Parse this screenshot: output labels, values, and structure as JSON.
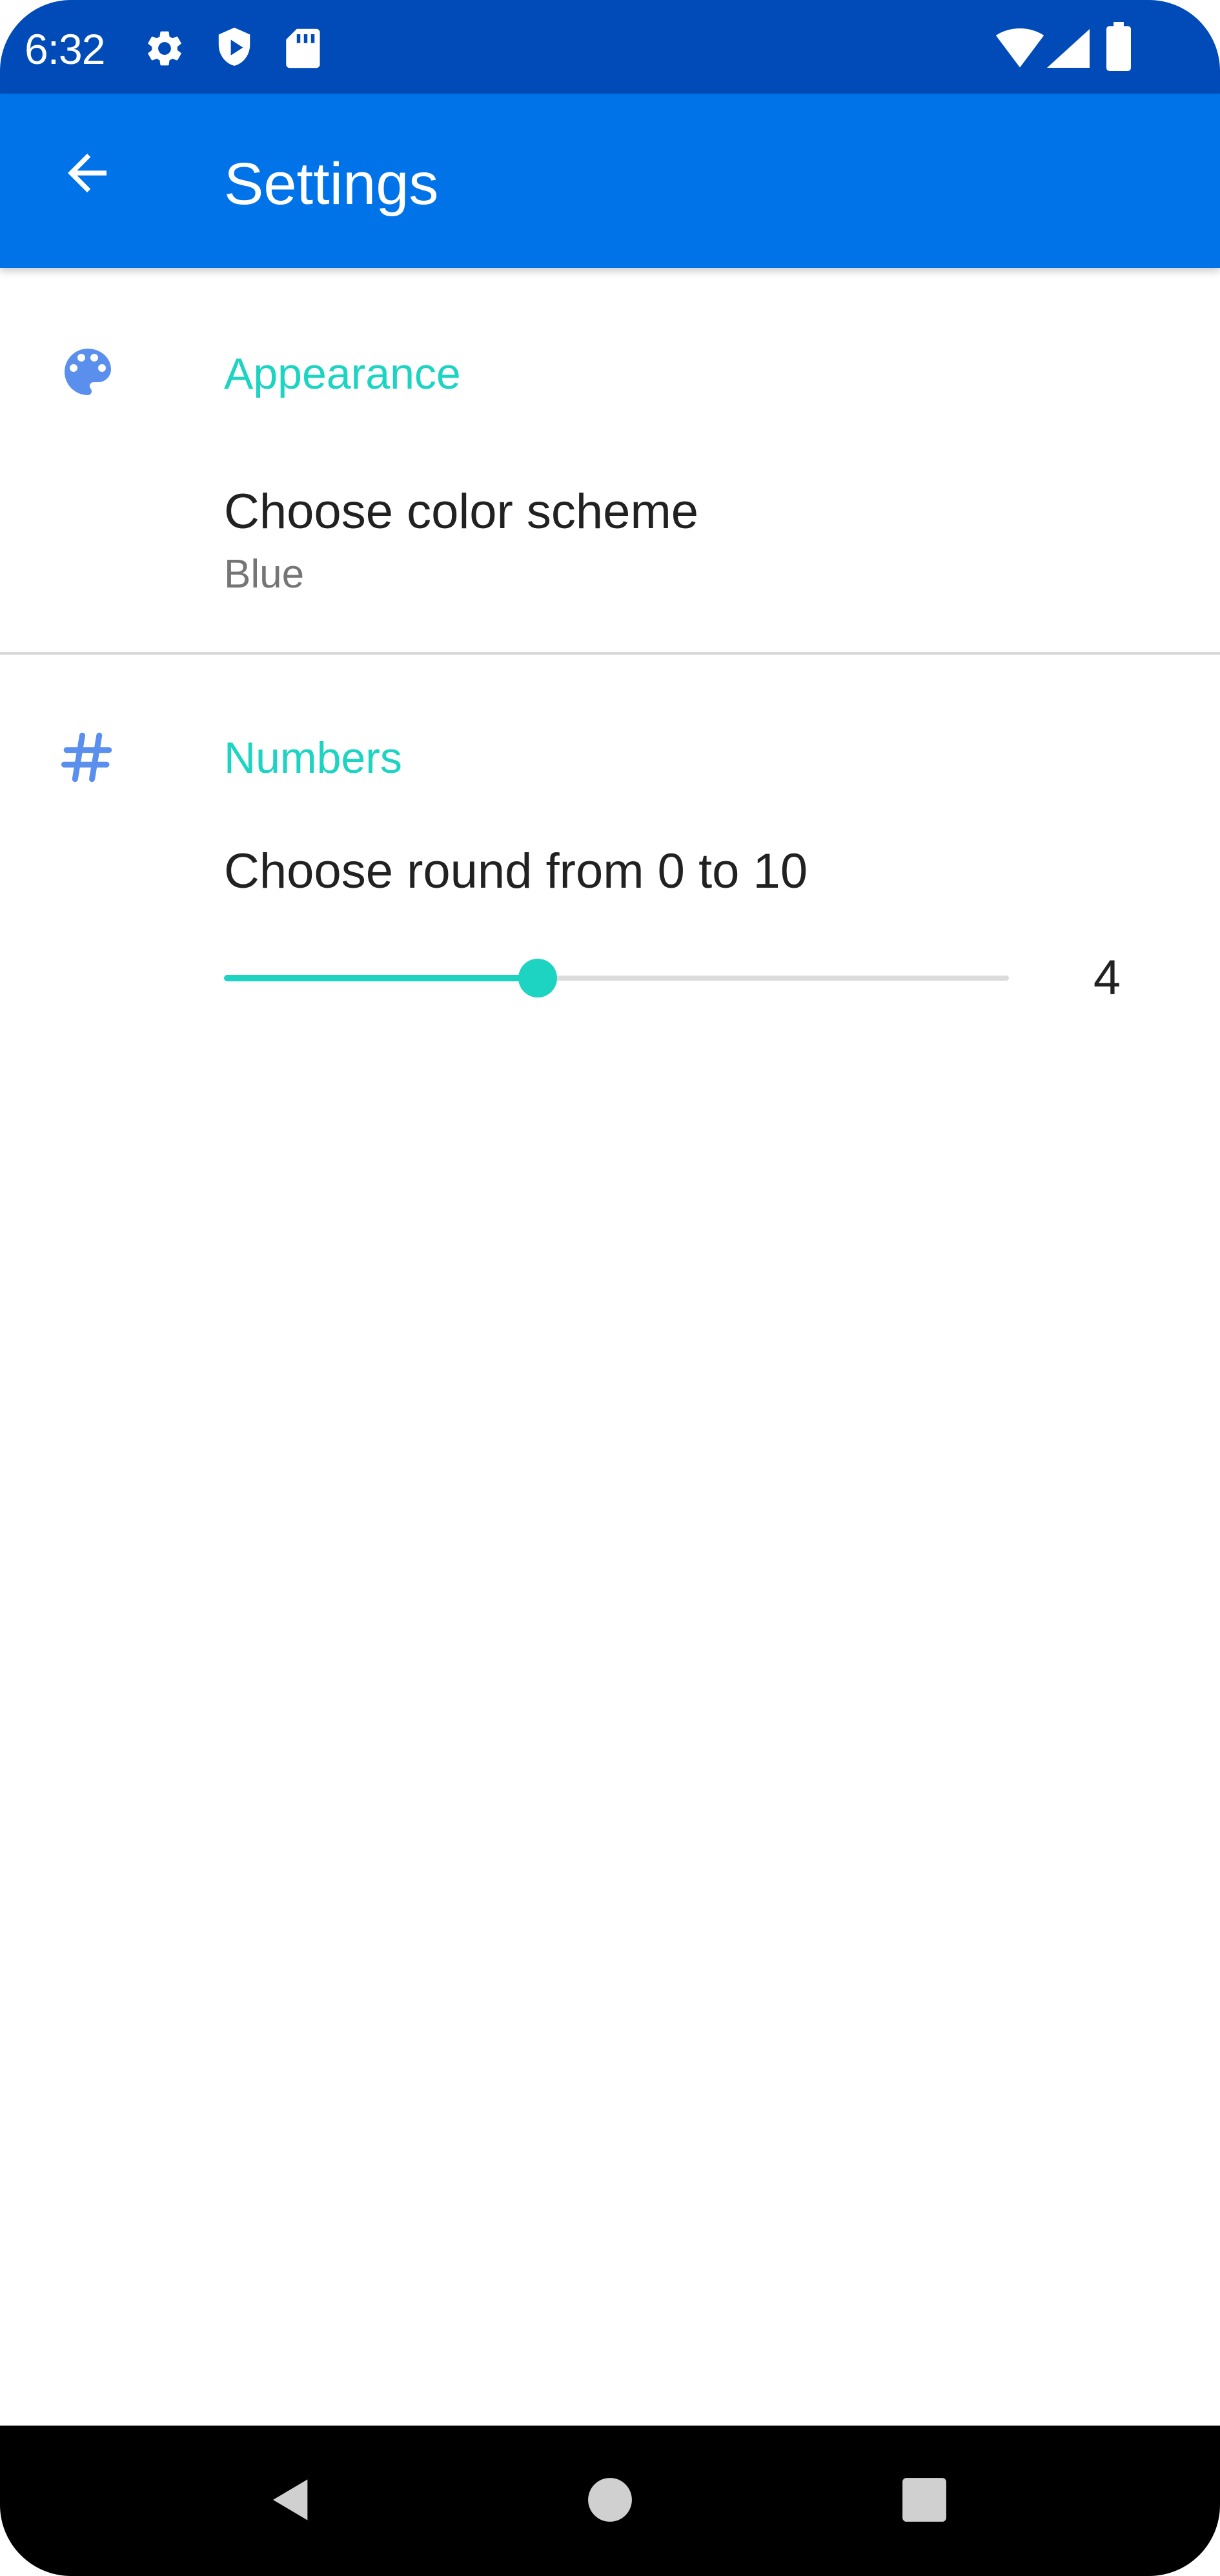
{
  "status_bar": {
    "time": "6:32",
    "left_icons": [
      "gear-icon",
      "shield-icon",
      "sd-card-icon"
    ],
    "right_icons": [
      "wifi-icon",
      "cellular-signal-icon",
      "battery-icon"
    ]
  },
  "app_bar": {
    "title": "Settings",
    "back_icon": "arrow-left-icon"
  },
  "sections": {
    "appearance": {
      "icon": "palette-icon",
      "header": "Appearance",
      "color_scheme": {
        "title": "Choose color scheme",
        "summary": "Blue"
      }
    },
    "numbers": {
      "icon": "hash-icon",
      "header": "Numbers",
      "round": {
        "title": "Choose round from 0 to 10",
        "min": 0,
        "max": 10,
        "value": "4"
      }
    }
  },
  "nav_bar": {
    "buttons": [
      "back-triangle-icon",
      "home-circle-icon",
      "recents-square-icon"
    ]
  },
  "colors": {
    "status_bar": "#004bb8",
    "app_bar": "#0073e8",
    "accent": "#1dd3c2",
    "section_icon": "#5b8fee",
    "text_primary": "#212121",
    "text_secondary": "#757575"
  }
}
